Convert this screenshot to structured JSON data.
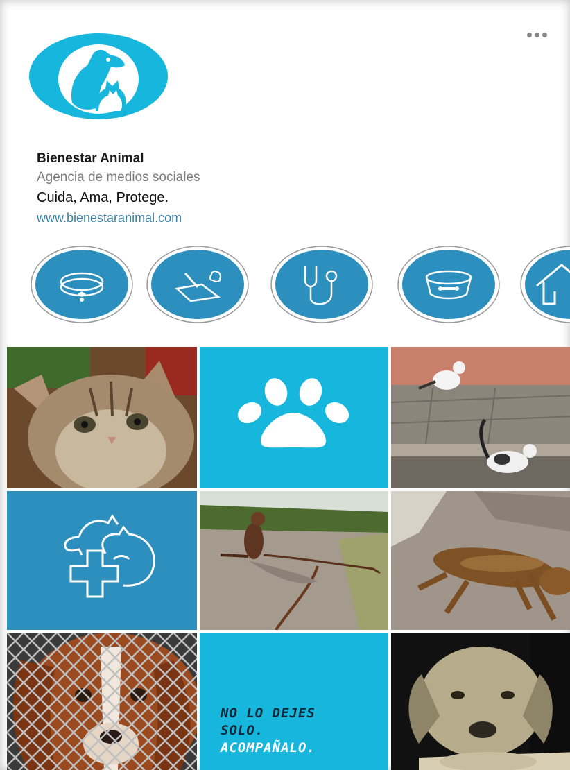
{
  "menu": {
    "more_icon": "more-horizontal-icon"
  },
  "profile": {
    "name": "Bienestar Animal",
    "category": "Agencia de medios sociales",
    "bio": "Cuida, Ama, Protege.",
    "website": "www.bienestaranimal.com",
    "avatar_icon": "dog-cat-logo-icon"
  },
  "colors": {
    "brand_cyan": "#17b6dd",
    "brand_blue": "#2c8fbe",
    "quote_dark": "#0d2b3a",
    "quote_light": "#ffffff"
  },
  "highlights": [
    {
      "icon": "pet-collar-icon"
    },
    {
      "icon": "litter-scoop-icon"
    },
    {
      "icon": "stethoscope-icon"
    },
    {
      "icon": "pet-food-bowl-icon"
    },
    {
      "icon": "dog-house-icon"
    }
  ],
  "posts": [
    {
      "kind": "photo",
      "subject": "kitten"
    },
    {
      "kind": "graphic",
      "icon": "paw-print-icon"
    },
    {
      "kind": "photo",
      "subject": "street-cats"
    },
    {
      "kind": "graphic",
      "icon": "pet-health-cross-icon"
    },
    {
      "kind": "photo",
      "subject": "dog-on-road"
    },
    {
      "kind": "photo",
      "subject": "sleeping-stray-dog"
    },
    {
      "kind": "photo",
      "subject": "dog-behind-fence"
    },
    {
      "kind": "quote",
      "lines": [
        "NO LO DEJES",
        "SOLO.",
        "ACOMPAÑALO."
      ]
    },
    {
      "kind": "photo",
      "subject": "sad-labrador"
    }
  ]
}
